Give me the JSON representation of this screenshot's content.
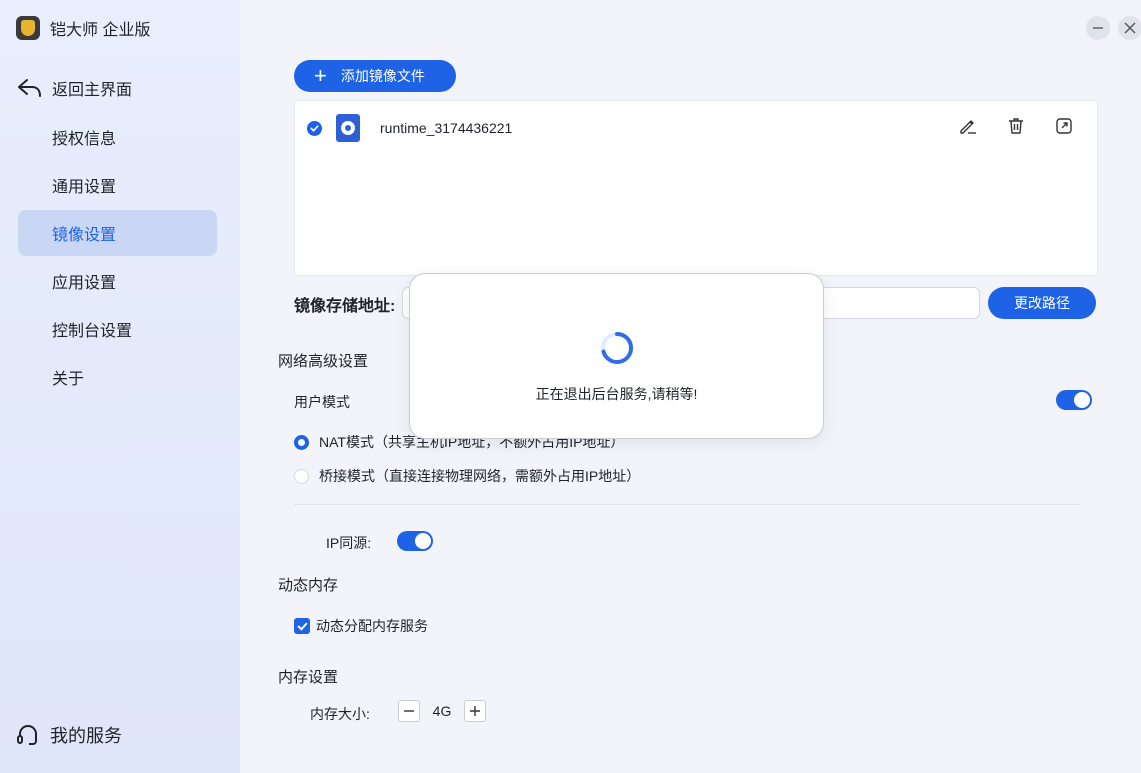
{
  "app": {
    "title": "铠大师 企业版"
  },
  "sidebar": {
    "back_label": "返回主界面",
    "items": [
      {
        "label": "授权信息",
        "active": false
      },
      {
        "label": "通用设置",
        "active": false
      },
      {
        "label": "镜像设置",
        "active": true
      },
      {
        "label": "应用设置",
        "active": false
      },
      {
        "label": "控制台设置",
        "active": false
      },
      {
        "label": "关于",
        "active": false
      }
    ],
    "service_label": "我的服务"
  },
  "main": {
    "add_image_label": "添加镜像文件",
    "images": [
      {
        "name": "runtime_3174436221",
        "checked": true
      }
    ],
    "storage_label": "镜像存储地址:",
    "storage_path": "",
    "change_path_label": "更改路径",
    "network": {
      "title": "网络高级设置",
      "user_mode_label": "用户模式",
      "user_mode_on": true,
      "nat_label": "NAT模式（共享主机IP地址，不额外占用IP地址）",
      "bridge_label": "桥接模式（直接连接物理网络，需额外占用IP地址）",
      "selected_mode": "nat",
      "ip_source_label": "IP同源:",
      "ip_source_on": true
    },
    "dynamic_memory": {
      "title": "动态内存",
      "checkbox_label": "动态分配内存服务",
      "checked": true
    },
    "memory": {
      "title": "内存设置",
      "size_label": "内存大小:",
      "value": "4G",
      "minus": "—",
      "plus": "+"
    }
  },
  "dialog": {
    "message": "正在退出后台服务,请稍等!"
  },
  "colors": {
    "accent": "#1e63e6",
    "sidebar_active_bg": "#c9d7f5",
    "main_bg": "#f2f4fa"
  }
}
